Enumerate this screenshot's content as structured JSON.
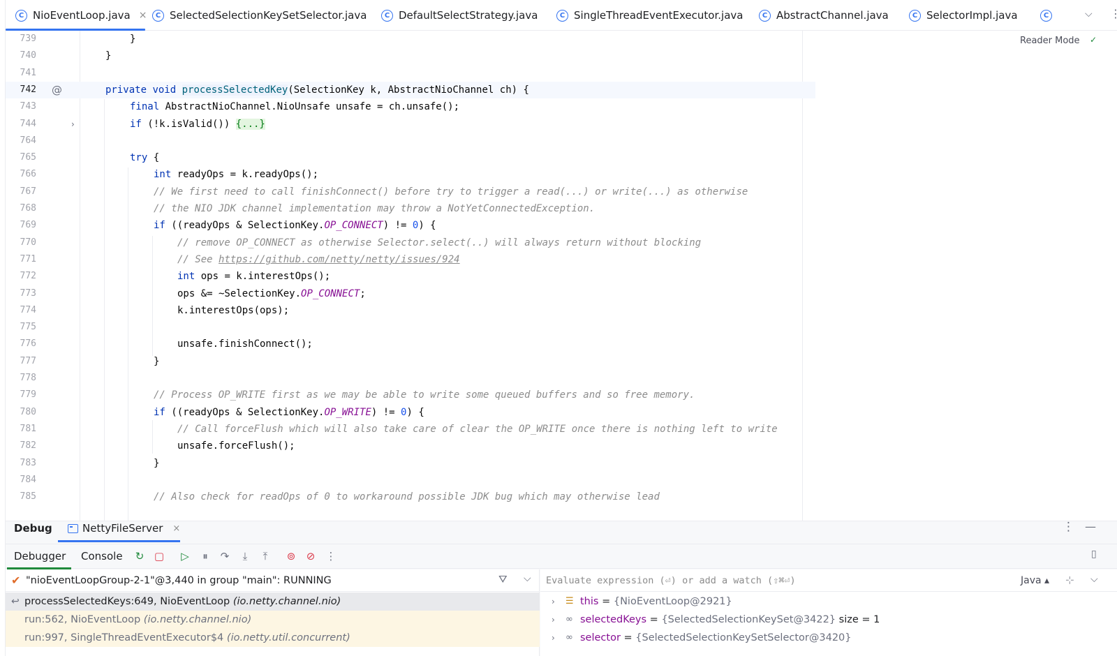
{
  "tabs": [
    {
      "label": "NioEventLoop.java",
      "close": "×",
      "active": true
    },
    {
      "label": "SelectedSelectionKeySetSelector.java"
    },
    {
      "label": "DefaultSelectStrategy.java"
    },
    {
      "label": "SingleThreadEventExecutor.java"
    },
    {
      "label": "AbstractChannel.java"
    },
    {
      "label": "SelectorImpl.java"
    }
  ],
  "editor": {
    "reader_mode": "Reader Mode",
    "caret_line": "742",
    "lines": [
      {
        "n": "739"
      },
      {
        "n": "740"
      },
      {
        "n": "741"
      },
      {
        "n": "742"
      },
      {
        "n": "743"
      },
      {
        "n": "744"
      },
      {
        "n": "764"
      },
      {
        "n": "765"
      },
      {
        "n": "766"
      },
      {
        "n": "767"
      },
      {
        "n": "768"
      },
      {
        "n": "769"
      },
      {
        "n": "770"
      },
      {
        "n": "771"
      },
      {
        "n": "772"
      },
      {
        "n": "773"
      },
      {
        "n": "774"
      },
      {
        "n": "775"
      },
      {
        "n": "776"
      },
      {
        "n": "777"
      },
      {
        "n": "778"
      },
      {
        "n": "779"
      },
      {
        "n": "780"
      },
      {
        "n": "781"
      },
      {
        "n": "782"
      },
      {
        "n": "783"
      },
      {
        "n": "784"
      },
      {
        "n": "785"
      }
    ],
    "code": {
      "l739": "}",
      "l740": "}",
      "l742_kw1": "private",
      "l742_kw2": "void",
      "l742_fn": "processSelectedKey",
      "l742_rest": "(SelectionKey k, AbstractNioChannel ch) {",
      "l743_kw": "final",
      "l743_rest": " AbstractNioChannel.NioUnsafe unsafe = ch.unsafe();",
      "l744_kw": "if",
      "l744_rest": " (!k.isValid()) ",
      "l744_fold": "{...}",
      "l765_kw": "try",
      "l765_rest": " {",
      "l766_kw": "int",
      "l766_rest": " readyOps = k.readyOps();",
      "l767": "// We first need to call finishConnect() before try to trigger a read(...) or write(...) as otherwise",
      "l768": "// the NIO JDK channel implementation may throw a NotYetConnectedException.",
      "l769_kw": "if",
      "l769_a": " ((readyOps & SelectionKey.",
      "l769_cst": "OP_CONNECT",
      "l769_b": ") != ",
      "l769_num": "0",
      "l769_c": ") {",
      "l770": "// remove OP_CONNECT as otherwise Selector.select(..) will always return without blocking",
      "l771_pre": "// See ",
      "l771_link": "https://github.com/netty/netty/issues/924",
      "l772_kw": "int",
      "l772_rest": " ops = k.interestOps();",
      "l773_a": "ops &= ~SelectionKey.",
      "l773_cst": "OP_CONNECT",
      "l773_b": ";",
      "l774": "k.interestOps(ops);",
      "l776": "unsafe.finishConnect();",
      "l777": "}",
      "l779": "// Process OP_WRITE first as we may be able to write some queued buffers and so free memory.",
      "l780_kw": "if",
      "l780_a": " ((readyOps & SelectionKey.",
      "l780_cst": "OP_WRITE",
      "l780_b": ") != ",
      "l780_num": "0",
      "l780_c": ") {",
      "l781": "// Call forceFlush which will also take care of clear the OP_WRITE once there is nothing left to write",
      "l782": "unsafe.forceFlush();",
      "l783": "}",
      "l785": "// Also check for readOps of 0 to workaround possible JDK bug which may otherwise lead"
    }
  },
  "debug": {
    "title": "Debug",
    "session": "NettyFileServer",
    "session_close": "×",
    "tabs": [
      "Debugger",
      "Console"
    ],
    "thread": "\"nioEventLoopGroup-2-1\"@3,440 in group \"main\": RUNNING",
    "frames": [
      {
        "method": "processSelectedKeys:649, NioEventLoop",
        "pkg": "(io.netty.channel.nio)"
      },
      {
        "method": "run:562, NioEventLoop",
        "pkg": "(io.netty.channel.nio)"
      },
      {
        "method": "run:997, SingleThreadEventExecutor$4",
        "pkg": "(io.netty.util.concurrent)"
      }
    ],
    "eval_placeholder": "Evaluate expression (⏎) or add a watch (⇧⌘⏎)",
    "eval_lang": "Java",
    "variables": [
      {
        "name": "this",
        "eq": " = ",
        "value": "{NioEventLoop@2921}",
        "extra": ""
      },
      {
        "name": "selectedKeys",
        "eq": " = ",
        "value": "{SelectedSelectionKeySet@3422}",
        "extra": "  size = 1"
      },
      {
        "name": "selector",
        "eq": " = ",
        "value": "{SelectedSelectionKeySetSelector@3420}",
        "extra": ""
      }
    ]
  },
  "colors": {
    "accent": "#3574f0",
    "keyword": "#0033b3",
    "method": "#00627a",
    "comment": "#8c8c8c",
    "constant": "#871094",
    "number": "#1750eb",
    "run_green": "#208a3c",
    "stop_red": "#db3b4b"
  }
}
